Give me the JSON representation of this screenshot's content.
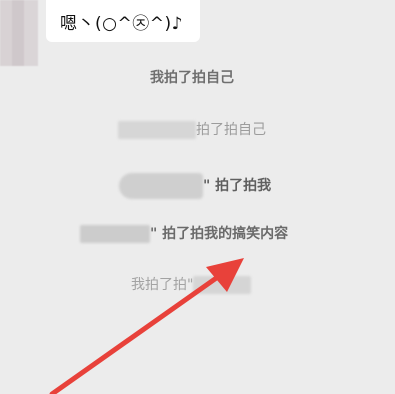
{
  "chat_bubble": {
    "text": "嗯丶(○^㉨^)♪"
  },
  "system_messages": [
    {
      "text": "我拍了拍自己"
    },
    {
      "text": "拍了拍自己"
    },
    {
      "text": "\" 拍了拍我"
    },
    {
      "text": "\" 拍了拍我的搞笑内容"
    },
    {
      "text": "我拍了拍\""
    }
  ],
  "colors": {
    "background": "#ececec",
    "bubble": "#ffffff",
    "arrow": "#e8413a"
  }
}
